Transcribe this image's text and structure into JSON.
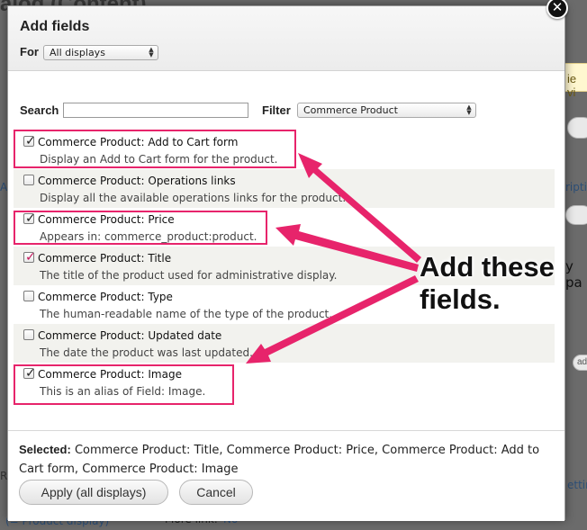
{
  "background": {
    "title_fragment": "alog (Content)",
    "warning_fragment": "ie vi",
    "link_fragment": "(= Product display)",
    "more_link_label": "More link:",
    "more_link_value": "No",
    "side_fragments": [
      "A",
      "ripti",
      "y pa",
      "ad",
      "R",
      "etting"
    ]
  },
  "modal": {
    "title": "Add fields",
    "for_label": "For",
    "for_select_value": "All displays",
    "search_label": "Search",
    "search_value": "",
    "filter_label": "Filter",
    "filter_select_value": "Commerce Product",
    "items": [
      {
        "name": "Commerce Product: Add to Cart form",
        "desc": "Display an Add to Cart form for the product.",
        "checked": true
      },
      {
        "name": "Commerce Product: Operations links",
        "desc": "Display all the available operations links for the product.",
        "checked": false
      },
      {
        "name": "Commerce Product: Price",
        "desc": "Appears in: commerce_product:product.",
        "checked": true
      },
      {
        "name": "Commerce Product: Title",
        "desc": "The title of the product used for administrative display.",
        "checked": true
      },
      {
        "name": "Commerce Product: Type",
        "desc": "The human-readable name of the type of the product.",
        "checked": false
      },
      {
        "name": "Commerce Product: Updated date",
        "desc": "The date the product was last updated.",
        "checked": false
      },
      {
        "name": "Commerce Product: Image",
        "desc": "This is an alias of Field: Image.",
        "checked": true
      }
    ],
    "selected_label": "Selected:",
    "selected_value": "Commerce Product: Title, Commerce Product: Price, Commerce Product: Add to Cart form, Commerce Product: Image",
    "apply_button": "Apply (all displays)",
    "cancel_button": "Cancel",
    "close_symbol": "✕"
  },
  "annotation": {
    "line1": "Add these",
    "line2": "fields."
  },
  "colors": {
    "highlight": "#e7246b",
    "link": "#2d4f77"
  }
}
